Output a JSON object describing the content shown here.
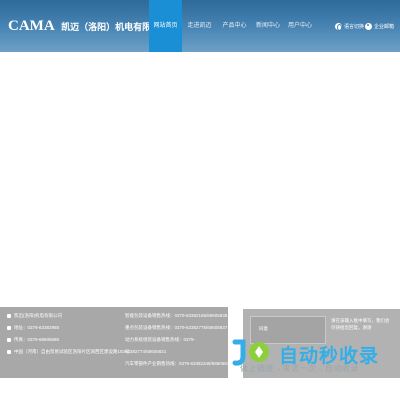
{
  "header": {
    "brand_en": "CAMA",
    "brand_cn": "凯迈（洛阳）机电有限公司",
    "nav": [
      {
        "label": "网站首页",
        "active": true
      },
      {
        "label": "走进凯迈",
        "active": false
      },
      {
        "label": "产品中心",
        "active": false
      },
      {
        "label": "新闻中心",
        "active": false
      },
      {
        "label": "用户中心",
        "active": false
      }
    ],
    "tools": {
      "language_label": "语言切换",
      "support_label": "企业邮箱"
    }
  },
  "footer": {
    "company": "凯迈(洛阳)机电有限公司",
    "address": "地址：0379-63382988",
    "fax": "传真：0379-68605688",
    "postal": "中国（河南）自由贸易试验区洛阳片区涧西区建设路192号",
    "sales": [
      "智能包装设备销售热线：0379-63382165/68605838",
      "重点包装设备销售热线：0379-63382775/68605837",
      "动力系统组装设备销售热线：0379-",
      "63382774/68605821",
      "汽车零部件产业销售热线：0379-63382348/68605830"
    ],
    "checkbox_label": "同意",
    "note": "请在该输入框中填写，我们会尽快给您回复。谢谢"
  },
  "watermark": {
    "title": "自动秒收录",
    "subtitle": "做上链接→来访一次→自动收录"
  },
  "colors": {
    "header_top": "#2d6a99",
    "nav_active": "#1a8fd6",
    "footer_bg": "#a8a8a8",
    "watermark_accent": "#35aee8"
  }
}
